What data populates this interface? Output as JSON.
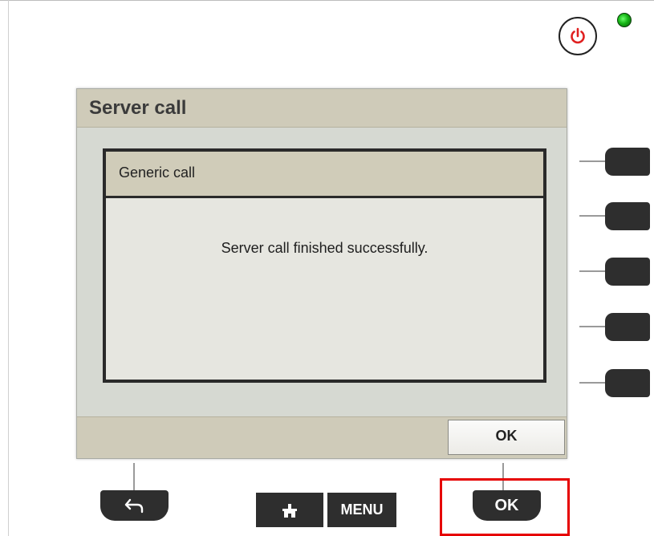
{
  "screen": {
    "title": "Server call",
    "dialog": {
      "title": "Generic call",
      "message": "Server call finished successfully."
    },
    "ok_label": "OK"
  },
  "hardware": {
    "menu_label": "MENU",
    "ok_label": "OK",
    "back_icon": "back-arrow-icon",
    "home_icon": "home-icon",
    "power_icon": "power-icon"
  },
  "colors": {
    "title_bar": "#cfcbb9",
    "screen_bg": "#d6d9d2",
    "key_dark": "#2e2e2e",
    "power_red": "#e02020",
    "led_green": "#15b415",
    "highlight_red": "#e60000"
  }
}
